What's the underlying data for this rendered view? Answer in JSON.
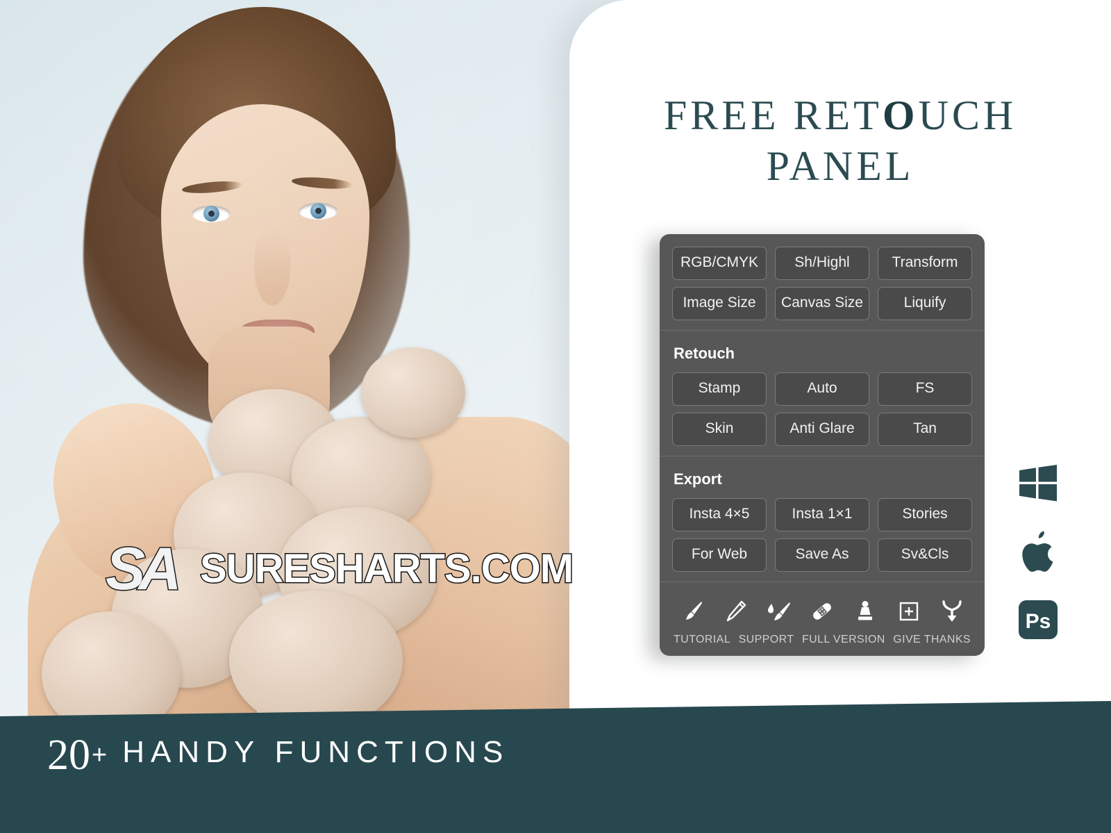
{
  "header": {
    "title_line1_pre": "FREE RET",
    "title_line1_accent": "O",
    "title_line1_post": "UCH",
    "title_line2": "PANEL",
    "title_color": "#2b4b51"
  },
  "panel": {
    "background_color": "#575757",
    "button_color": "#4a4a4a",
    "sections": [
      {
        "name": "general",
        "title": "",
        "buttons": [
          "RGB/CMYK",
          "Sh/Highl",
          "Transform",
          "Image Size",
          "Canvas Size",
          "Liquify"
        ]
      },
      {
        "name": "retouch",
        "title": "Retouch",
        "buttons": [
          "Stamp",
          "Auto",
          "FS",
          "Skin",
          "Anti Glare",
          "Tan"
        ]
      },
      {
        "name": "export",
        "title": "Export",
        "buttons": [
          "Insta 4×5",
          "Insta 1×1",
          "Stories",
          "For Web",
          "Save As",
          "Sv&Cls"
        ]
      }
    ],
    "tools": [
      "brush-icon",
      "pencil-icon",
      "mixer-brush-icon",
      "patch-bandage-icon",
      "clone-stamp-icon",
      "new-layer-plus-icon",
      "merge-stamp-visible-icon"
    ],
    "footer_labels": [
      "TUTORIAL",
      "SUPPORT",
      "FULL VERSION",
      "GIVE THANKS"
    ]
  },
  "badges": [
    {
      "name": "windows-logo-icon",
      "label": "Windows"
    },
    {
      "name": "apple-logo-icon",
      "label": "Apple"
    },
    {
      "name": "photoshop-logo-icon",
      "label": "Ps"
    }
  ],
  "banner": {
    "number": "20",
    "plus": "+",
    "words": "HANDY FUNCTIONS",
    "background_color": "#27484e"
  },
  "watermark": {
    "logo_text": "SA",
    "domain_text": "SURESHARTS.COM",
    "accent_color": "#d2232a"
  }
}
